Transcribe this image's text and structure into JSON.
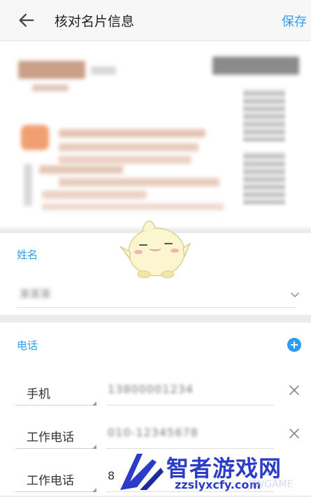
{
  "header": {
    "title": "核对名片信息",
    "save_label": "保存"
  },
  "name_section": {
    "label": "姓名",
    "value": "某某某"
  },
  "phone_section": {
    "label": "电话",
    "rows": [
      {
        "type": "手机",
        "number": "13800001234"
      },
      {
        "type": "工作电话",
        "number": "010-12345678"
      },
      {
        "type": "工作电话",
        "number": "8"
      }
    ]
  },
  "watermark": {
    "title": "智者游戏网",
    "url": "zzslyxcfy.com",
    "faint": "JIWGAME"
  },
  "colors": {
    "accent": "#2e9cf0",
    "watermark": "#2b3cc6"
  }
}
